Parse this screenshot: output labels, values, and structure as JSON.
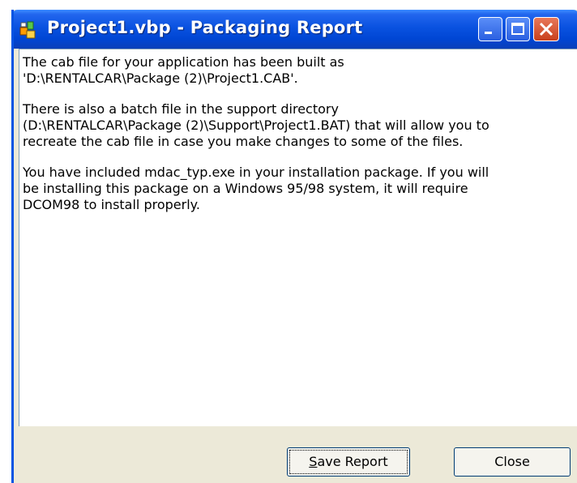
{
  "window": {
    "title": "Project1.vbp - Packaging Report",
    "app_icon": "vb-project-icon",
    "controls": [
      "minimize-icon",
      "maximize-icon",
      "close-icon"
    ]
  },
  "report": {
    "paragraphs": [
      "The cab file for your application has been built as\n'D:\\RENTALCAR\\Package (2)\\Project1.CAB'.",
      "There is also a batch file in the support directory\n(D:\\RENTALCAR\\Package (2)\\Support\\Project1.BAT) that will allow you to\nrecreate the cab file in case you make changes to some of the files.",
      "You have included mdac_typ.exe in your installation package.  If you will\nbe installing this package on a Windows 95/98 system, it will require\nDCOM98 to install properly."
    ]
  },
  "buttons": {
    "save_mnemonic": "S",
    "save_rest": "ave Report",
    "close": "Close"
  },
  "colors": {
    "titlebar": "#0a52e0",
    "close_button": "#c8401c",
    "dialog_face": "#ece9d8"
  }
}
